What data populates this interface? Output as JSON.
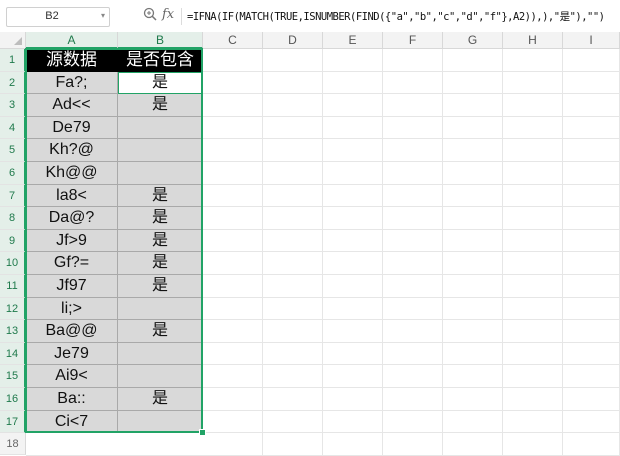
{
  "formula_bar": {
    "cell_ref": "B2",
    "zoom_icon": "zoom-icon",
    "fx_label": "fx",
    "formula": "=IFNA(IF(MATCH(TRUE,ISNUMBER(FIND({\"a\",\"b\",\"c\",\"d\",\"f\"},A2)),),\"是\"),\"\")"
  },
  "columns": [
    "A",
    "B",
    "C",
    "D",
    "E",
    "F",
    "G",
    "H",
    "I"
  ],
  "header_row": {
    "row_num": "1",
    "a": "源数据",
    "b": "是否包含"
  },
  "rows": [
    {
      "n": "2",
      "a": "Fa?;",
      "b": "是"
    },
    {
      "n": "3",
      "a": "Ad<<",
      "b": "是"
    },
    {
      "n": "4",
      "a": "De79",
      "b": ""
    },
    {
      "n": "5",
      "a": "Kh?@",
      "b": ""
    },
    {
      "n": "6",
      "a": "Kh@@",
      "b": ""
    },
    {
      "n": "7",
      "a": "la8<",
      "b": "是"
    },
    {
      "n": "8",
      "a": "Da@?",
      "b": "是"
    },
    {
      "n": "9",
      "a": "Jf>9",
      "b": "是"
    },
    {
      "n": "10",
      "a": "Gf?=",
      "b": "是"
    },
    {
      "n": "11",
      "a": "Jf97",
      "b": "是"
    },
    {
      "n": "12",
      "a": "li;>",
      "b": ""
    },
    {
      "n": "13",
      "a": "Ba@@",
      "b": "是"
    },
    {
      "n": "14",
      "a": "Je79",
      "b": ""
    },
    {
      "n": "15",
      "a": "Ai9<",
      "b": ""
    },
    {
      "n": "16",
      "a": "Ba::",
      "b": "是"
    },
    {
      "n": "17",
      "a": "Ci<7",
      "b": ""
    }
  ],
  "last_row_num": "18",
  "colors": {
    "selection": "#21a366",
    "header_fill": "#000000",
    "data_fill": "#d9d9d9"
  }
}
